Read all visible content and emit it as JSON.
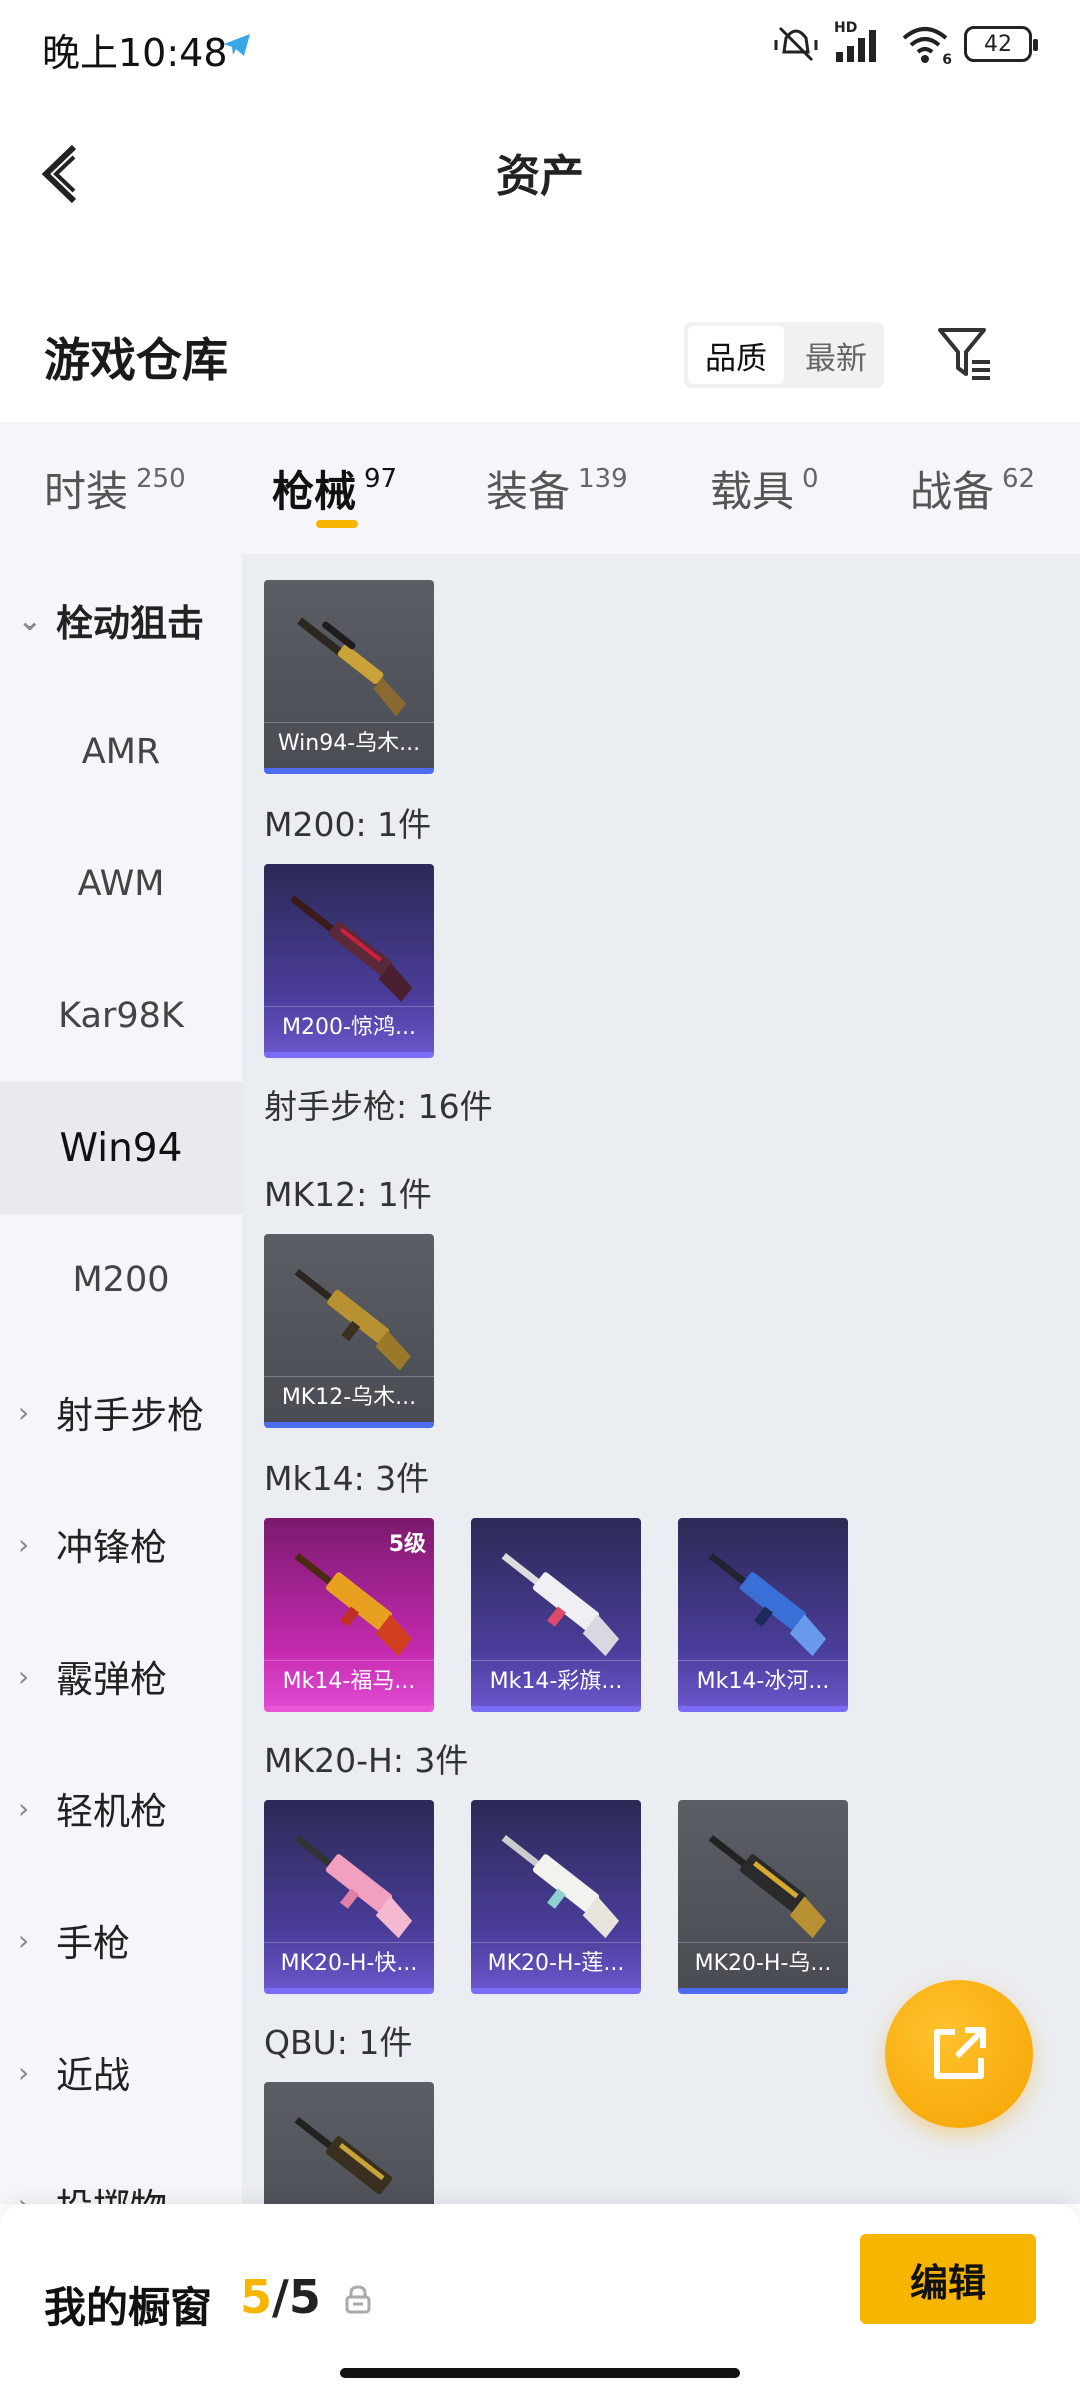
{
  "status_bar": {
    "time": "晚上10:48",
    "battery": "42",
    "network": "HD",
    "wifi_tag": "6"
  },
  "header": {
    "title": "资产"
  },
  "warehouse": {
    "title": "游戏仓库",
    "sort_options": [
      "品质",
      "最新"
    ],
    "sort_selected": "品质"
  },
  "tabs": [
    {
      "label": "时装",
      "count": "250"
    },
    {
      "label": "枪械",
      "count": "97",
      "active": true
    },
    {
      "label": "装备",
      "count": "139"
    },
    {
      "label": "载具",
      "count": "0"
    },
    {
      "label": "战备",
      "count": "62"
    }
  ],
  "sidebar": {
    "items": [
      {
        "label": "栓动狙击",
        "kind": "category",
        "expanded": true
      },
      {
        "label": "AMR",
        "kind": "sub"
      },
      {
        "label": "AWM",
        "kind": "sub"
      },
      {
        "label": "Kar98K",
        "kind": "sub"
      },
      {
        "label": "Win94",
        "kind": "sub",
        "selected": true
      },
      {
        "label": "M200",
        "kind": "sub"
      },
      {
        "label": "射手步枪",
        "kind": "category"
      },
      {
        "label": "冲锋枪",
        "kind": "category"
      },
      {
        "label": "霰弹枪",
        "kind": "category"
      },
      {
        "label": "轻机枪",
        "kind": "category"
      },
      {
        "label": "手枪",
        "kind": "category"
      },
      {
        "label": "近战",
        "kind": "category"
      },
      {
        "label": "投掷物",
        "kind": "category"
      }
    ]
  },
  "content": {
    "sections": [
      {
        "label": "",
        "cards": [
          {
            "name": "Win94-乌木...",
            "rarity": "grey"
          }
        ]
      },
      {
        "label": "M200: 1件",
        "cards": [
          {
            "name": "M200-惊鸿...",
            "rarity": "purple"
          }
        ]
      },
      {
        "label": "射手步枪: 16件",
        "cards": []
      },
      {
        "label": "MK12: 1件",
        "cards": [
          {
            "name": "MK12-乌木...",
            "rarity": "grey"
          }
        ]
      },
      {
        "label": "Mk14: 3件",
        "cards": [
          {
            "name": "Mk14-福马...",
            "rarity": "pink",
            "level": "5级"
          },
          {
            "name": "Mk14-彩旗...",
            "rarity": "purple"
          },
          {
            "name": "Mk14-冰河...",
            "rarity": "purple"
          }
        ]
      },
      {
        "label": "MK20-H: 3件",
        "cards": [
          {
            "name": "MK20-H-快...",
            "rarity": "purple"
          },
          {
            "name": "MK20-H-莲...",
            "rarity": "purple"
          },
          {
            "name": "MK20-H-乌...",
            "rarity": "grey"
          }
        ]
      },
      {
        "label": "QBU: 1件",
        "cards": [
          {
            "name": "",
            "rarity": "grey"
          }
        ]
      }
    ]
  },
  "bottom_bar": {
    "title": "我的橱窗",
    "count_current": "5",
    "count_sep": "/",
    "count_total": "5",
    "edit_label": "编辑"
  },
  "colors": {
    "accent": "#f5b500",
    "sidebar_bg": "#f4f6f9",
    "content_bg": "#eaedf1"
  },
  "icons": {
    "back": "chevron-left-icon",
    "filter": "filter-list-icon",
    "share": "external-link-icon",
    "lock": "lock-icon"
  }
}
